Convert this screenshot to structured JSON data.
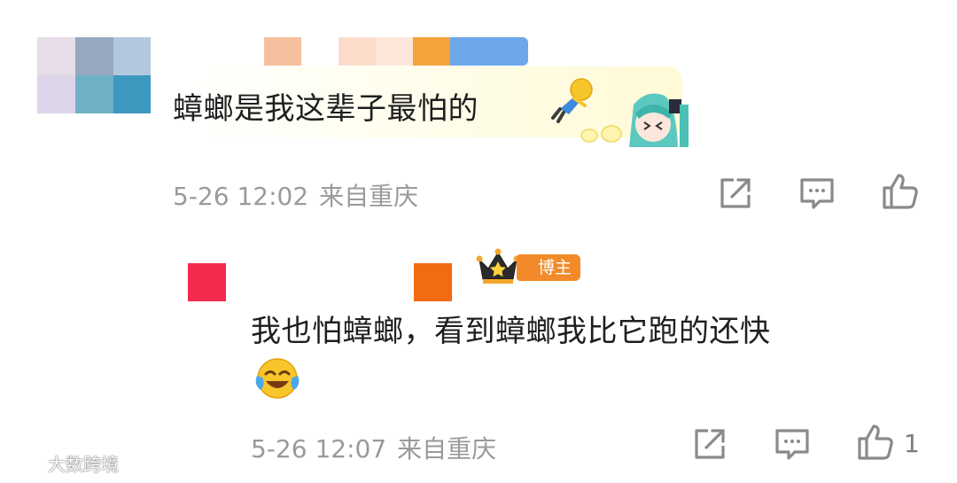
{
  "comment1": {
    "text": "蟑螂是我这辈子最怕的",
    "time": "5-26 12:02",
    "location": "来自重庆"
  },
  "reply1": {
    "badge": "博主",
    "text_line1": "我也怕蟑螂，看到蟑螂我比它跑的还快",
    "time": "5-26 12:07",
    "location": "来自重庆",
    "like_count": "1"
  },
  "watermark": {
    "text": "大数跨境"
  },
  "colors": {
    "meta_gray": "#9a9a9a",
    "badge_orange": "#f28a2a",
    "text_dark": "#1f1f1f"
  },
  "icons": [
    "share-icon",
    "comment-icon",
    "like-icon",
    "crown-icon",
    "emoji-falling-person",
    "emoji-laugh-cry",
    "sticker-anime-girl"
  ]
}
